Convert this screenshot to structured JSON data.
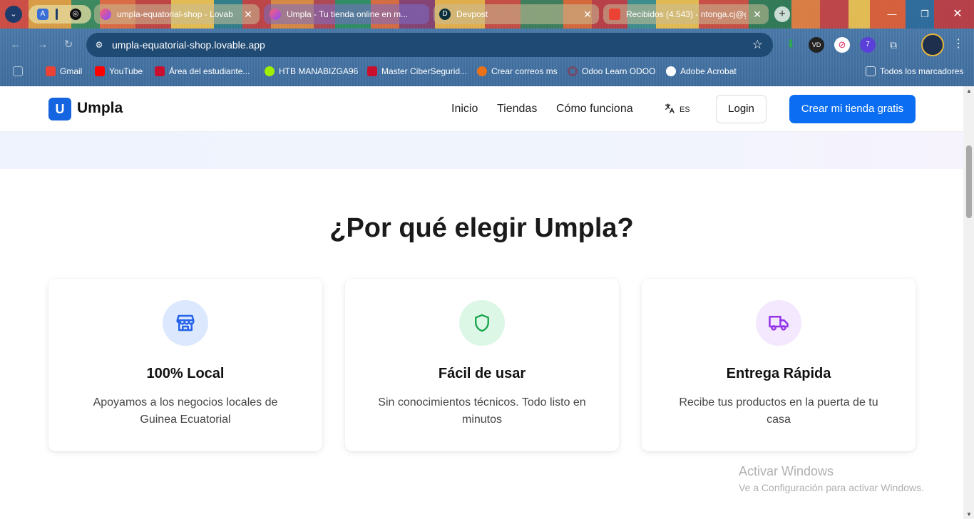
{
  "browser": {
    "tabs": [
      {
        "title": "umpla-equatorial-shop - Lovab",
        "active": false
      },
      {
        "title": "Umpla - Tu tienda online en m...",
        "active": true
      },
      {
        "title": "Devpost",
        "active": false
      },
      {
        "title": "Recibidos (4.543) - ntonga.cj@g",
        "active": false
      }
    ],
    "new_tab": "+",
    "close_glyph": "✕",
    "url": "umpla-equatorial-shop.lovable.app",
    "extension_badge": "7",
    "bookmarks": [
      {
        "label": "Gmail"
      },
      {
        "label": "YouTube"
      },
      {
        "label": "Área del estudiante..."
      },
      {
        "label": "HTB MANABIZGA96"
      },
      {
        "label": "Master CiberSegurid..."
      },
      {
        "label": "Crear correos ms"
      },
      {
        "label": "Odoo Learn ODOO"
      },
      {
        "label": "Adobe Acrobat"
      }
    ],
    "all_bookmarks": "Todos los marcadores",
    "icon_colors": {
      "gmail": "#ea4335",
      "youtube": "#ff0000",
      "imf": "#c8102e",
      "htb": "#9fef00",
      "crear": "#e8711a",
      "odoo": "#714b67",
      "adobe": "#ffffff"
    }
  },
  "site": {
    "logo_letter": "U",
    "brand": "Umpla",
    "nav": [
      "Inicio",
      "Tiendas",
      "Cómo funciona"
    ],
    "lang_code": "ES",
    "login": "Login",
    "cta": "Crear mi tienda gratis",
    "accent_color": "#0b6ef2"
  },
  "features": {
    "title": "¿Por qué elegir Umpla?",
    "cards": [
      {
        "icon": "store-icon",
        "title": "100% Local",
        "desc": "Apoyamos a los negocios locales de Guinea Ecuatorial",
        "icon_bg": "#dbe8fd",
        "icon_color": "#2563eb"
      },
      {
        "icon": "shield-icon",
        "title": "Fácil de usar",
        "desc": "Sin conocimientos técnicos. Todo listo en minutos",
        "icon_bg": "#dcf7e6",
        "icon_color": "#16a34a"
      },
      {
        "icon": "truck-icon",
        "title": "Entrega Rápida",
        "desc": "Recibe tus productos en la puerta de tu casa",
        "icon_bg": "#f3e8fd",
        "icon_color": "#9333ea"
      }
    ]
  },
  "watermark": {
    "title": "Activar Windows",
    "subtitle": "Ve a Configuración para activar Windows."
  }
}
